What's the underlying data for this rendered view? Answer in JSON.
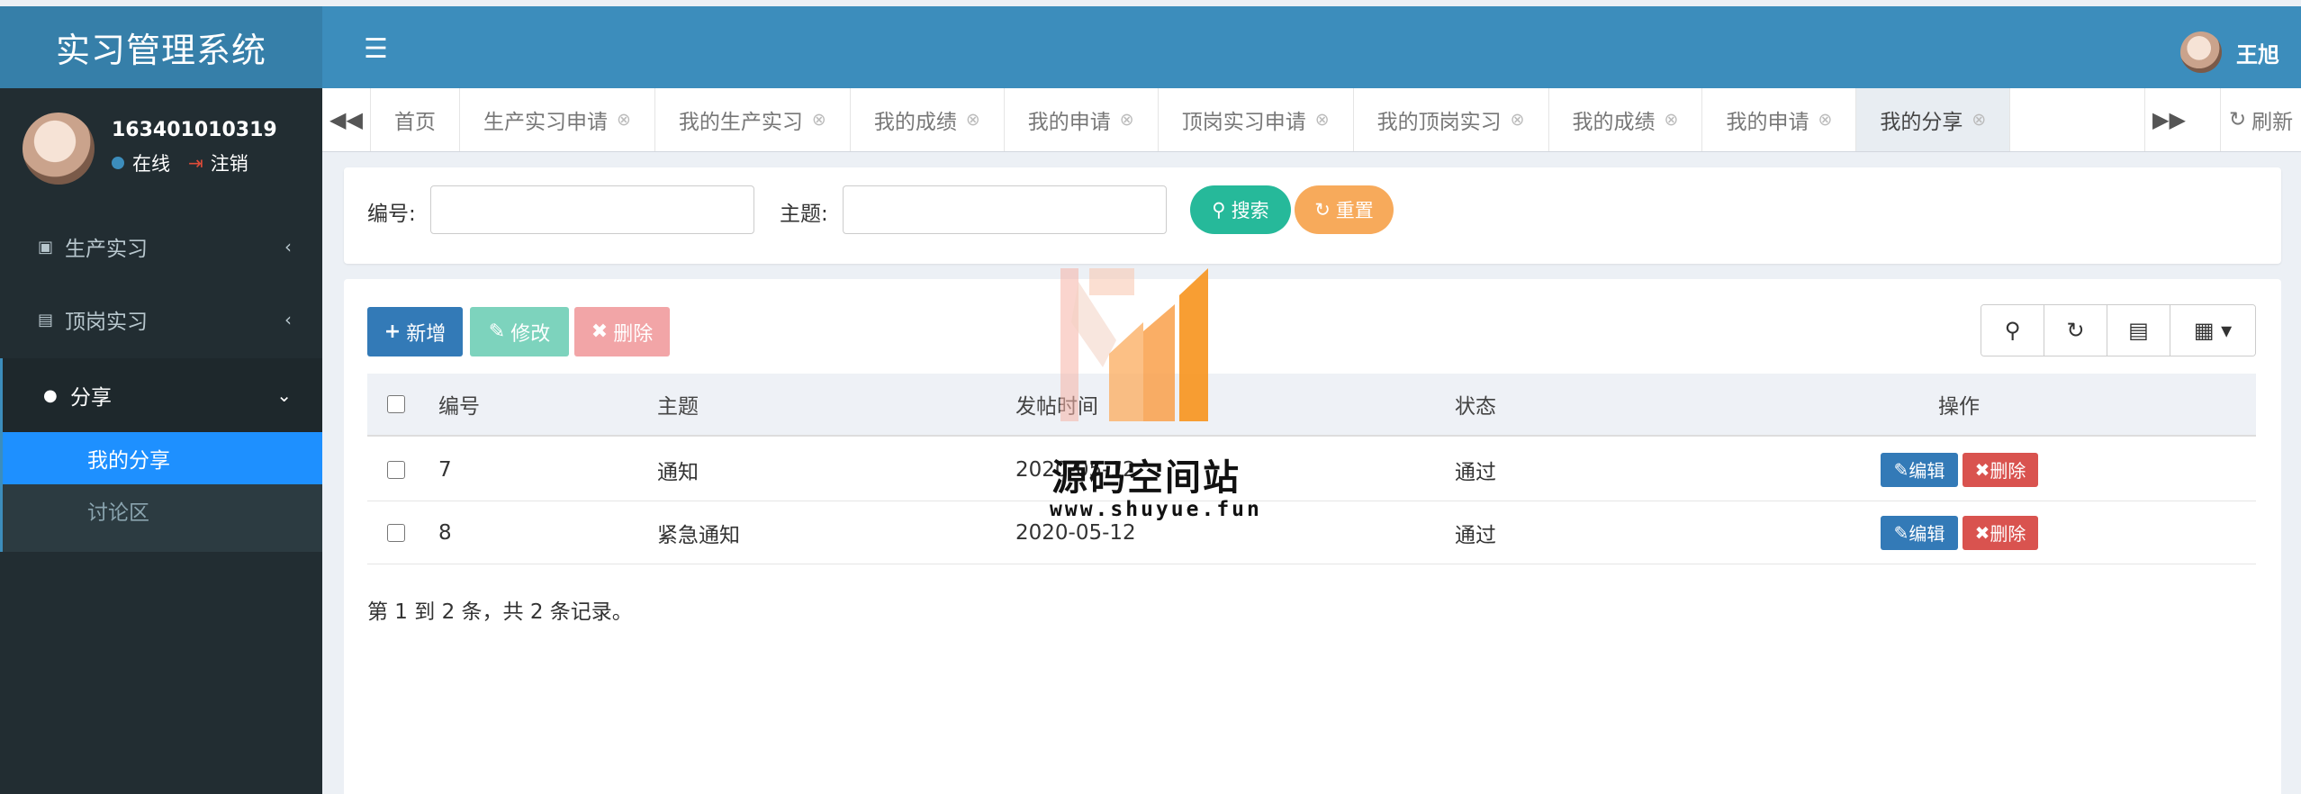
{
  "app": {
    "title": "实习管理系统"
  },
  "user": {
    "id": "163401010319",
    "status": "在线",
    "logout": "注销",
    "name": "王旭"
  },
  "sidebar": {
    "items": [
      {
        "label": "生产实习",
        "icon": "id-card-icon"
      },
      {
        "label": "顶岗实习",
        "icon": "address-card-icon"
      },
      {
        "label": "分享",
        "icon": "comment-icon"
      }
    ],
    "sub_items": [
      {
        "label": "我的分享"
      },
      {
        "label": "讨论区"
      }
    ]
  },
  "tabs": [
    {
      "label": "首页"
    },
    {
      "label": "生产实习申请"
    },
    {
      "label": "我的生产实习"
    },
    {
      "label": "我的成绩"
    },
    {
      "label": "我的申请"
    },
    {
      "label": "顶岗实习申请"
    },
    {
      "label": "我的顶岗实习"
    },
    {
      "label": "我的成绩"
    },
    {
      "label": "我的申请"
    },
    {
      "label": "我的分享"
    }
  ],
  "toolbar_top": {
    "refresh": "刷新"
  },
  "search": {
    "id_label": "编号:",
    "subject_label": "主题:",
    "search_btn": "搜索",
    "reset_btn": "重置"
  },
  "table": {
    "add_btn": "新增",
    "edit_btn": "修改",
    "delete_btn": "删除",
    "headers": {
      "id": "编号",
      "subject": "主题",
      "time": "发帖时间",
      "status": "状态",
      "ops": "操作"
    },
    "rows": [
      {
        "id": "7",
        "subject": "通知",
        "time": "2020-05-12",
        "status": "通过"
      },
      {
        "id": "8",
        "subject": "紧急通知",
        "time": "2020-05-12",
        "status": "通过"
      }
    ],
    "row_edit": "编辑",
    "row_delete": "删除",
    "footer": "第 1 到 2 条，共 2 条记录。"
  },
  "watermark": {
    "title": "源码空间站",
    "url": "www.shuyue.fun"
  },
  "colors": {
    "header": "#3c8dbc",
    "logo": "#367fa9",
    "sidebar": "#222d32",
    "primary": "#337ab7",
    "success": "#26b99a",
    "warning": "#f7aa5b",
    "danger": "#d9534f",
    "selected": "#1e90ff"
  }
}
